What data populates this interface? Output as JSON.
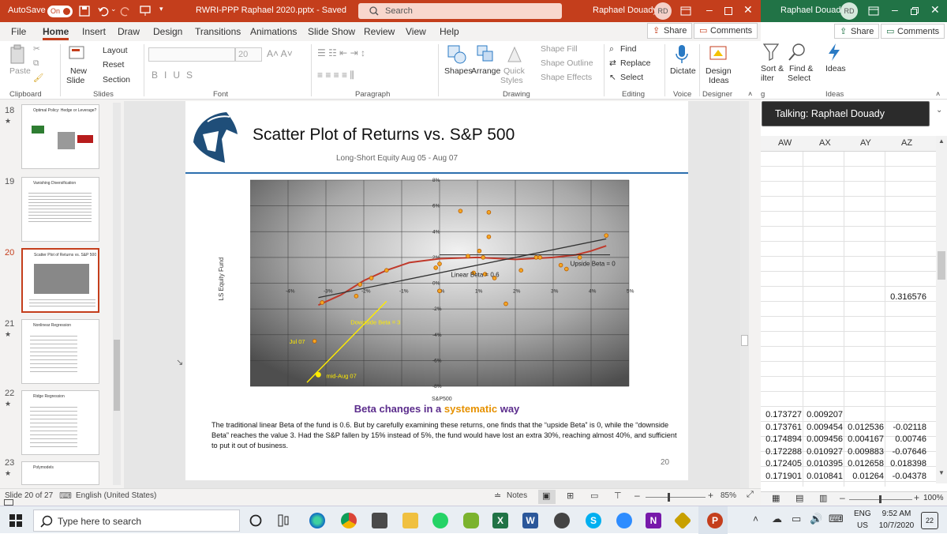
{
  "powerpoint": {
    "autosave_label": "AutoSave",
    "autosave_state": "On",
    "file_title": "RWRI-PPP Raphael 2020.pptx  -  Saved",
    "search_placeholder": "Search",
    "user_name": "Raphael Douady",
    "user_initials": "RD",
    "menu": [
      "File",
      "Home",
      "Insert",
      "Draw",
      "Design",
      "Transitions",
      "Animations",
      "Slide Show",
      "Review",
      "View",
      "Help"
    ],
    "share_label": "Share",
    "comments_label": "Comments",
    "ribbon": {
      "clipboard": {
        "paste": "Paste",
        "group": "Clipboard"
      },
      "slides": {
        "new_slide_1": "New",
        "new_slide_2": "Slide",
        "layout": "Layout",
        "reset": "Reset",
        "section": "Section",
        "group": "Slides"
      },
      "font": {
        "size": "20",
        "group": "Font"
      },
      "paragraph": {
        "group": "Paragraph"
      },
      "drawing": {
        "shapes": "Shapes",
        "arrange": "Arrange",
        "quick_styles_1": "Quick",
        "quick_styles_2": "Styles",
        "shape_fill": "Shape Fill",
        "shape_outline": "Shape Outline",
        "shape_effects": "Shape Effects",
        "group": "Drawing"
      },
      "editing": {
        "find": "Find",
        "replace": "Replace",
        "select": "Select",
        "group": "Editing"
      },
      "voice": {
        "dictate": "Dictate",
        "group": "Voice"
      },
      "designer": {
        "design_ideas_1": "Design",
        "design_ideas_2": "Ideas",
        "group": "Designer"
      }
    },
    "thumbnails": [
      {
        "num": "18",
        "title": "Optimal Policy: Hedge or Leverage?",
        "selected": false
      },
      {
        "num": "19",
        "title": "Vanishing Diversification",
        "selected": false
      },
      {
        "num": "20",
        "title": "Scatter Plot of Returns vs. S&P 500",
        "selected": true
      },
      {
        "num": "21",
        "title": "Nonlinear Regression",
        "selected": false
      },
      {
        "num": "22",
        "title": "Ridge Regression",
        "selected": false
      },
      {
        "num": "23",
        "title": "Polymodels",
        "selected": false
      }
    ],
    "status": {
      "slide_info": "Slide 20 of 27",
      "language": "English (United States)",
      "notes": "Notes",
      "zoom": "85%"
    }
  },
  "slide": {
    "title": "Scatter Plot of Returns vs. S&P 500",
    "subtitle": "Long-Short Equity Aug 05 - Aug 07",
    "headline_part1": "Beta changes in a ",
    "headline_highlight": "systematic",
    "headline_part2": " way",
    "body": "The traditional linear Beta of the fund is 0.6. But by carefully examining these returns, one finds that the “upside Beta” is 0, while the “downside Beta” reaches the value 3. Had the S&P fallen by 15% instead of 5%, the fund would have lost an extra 30%, reaching almost 40%, and sufficient to put it out of business.",
    "page_number": "20"
  },
  "chart_data": {
    "type": "scatter",
    "xlabel": "S&P500",
    "ylabel": "LS Equity Fund",
    "xlim": [
      -5,
      5
    ],
    "ylim": [
      -8,
      8
    ],
    "x_ticks": [
      "-4%",
      "-3%",
      "-2%",
      "-1%",
      "0%",
      "1%",
      "2%",
      "3%",
      "4%",
      "5%"
    ],
    "x_tick_values": [
      -4,
      -3,
      -2,
      -1,
      0,
      1,
      2,
      3,
      4,
      5
    ],
    "y_ticks": [
      "8%",
      "6%",
      "4%",
      "2%",
      "0%",
      "-2%",
      "-4%",
      "-6%",
      "-8%"
    ],
    "y_tick_values": [
      8,
      6,
      4,
      2,
      0,
      -2,
      -4,
      -6,
      -8
    ],
    "points": [
      {
        "x": 0.55,
        "y": 5.6
      },
      {
        "x": 1.3,
        "y": 5.5
      },
      {
        "x": 1.3,
        "y": 3.6
      },
      {
        "x": 1.05,
        "y": 2.5
      },
      {
        "x": 0.75,
        "y": 2.1
      },
      {
        "x": 1.15,
        "y": 2.0
      },
      {
        "x": 0.0,
        "y": 1.5
      },
      {
        "x": -0.1,
        "y": 1.2
      },
      {
        "x": 0.9,
        "y": 0.8
      },
      {
        "x": 1.45,
        "y": 0.4
      },
      {
        "x": 1.2,
        "y": 0.7
      },
      {
        "x": 2.15,
        "y": 1.0
      },
      {
        "x": 2.55,
        "y": 2.0
      },
      {
        "x": 2.65,
        "y": 2.0
      },
      {
        "x": 3.2,
        "y": 1.4
      },
      {
        "x": 3.35,
        "y": 1.1
      },
      {
        "x": 3.7,
        "y": 2.0
      },
      {
        "x": 4.4,
        "y": 3.7
      },
      {
        "x": 1.75,
        "y": -1.6
      },
      {
        "x": 0.0,
        "y": -0.6
      },
      {
        "x": -1.8,
        "y": 0.4
      },
      {
        "x": -2.1,
        "y": -0.1
      },
      {
        "x": -2.2,
        "y": -1.0
      },
      {
        "x": -3.1,
        "y": -1.5
      },
      {
        "x": -1.4,
        "y": 1.0
      },
      {
        "x": -3.3,
        "y": -4.5
      }
    ],
    "special_points": [
      {
        "x": -3.2,
        "y": -7.1,
        "label": "mid-Aug 07"
      },
      {
        "x": -3.3,
        "y": -4.5,
        "label": "Jul 07"
      }
    ],
    "linear_fit": {
      "label": "Linear Beta = 0.6",
      "slope": 0.6,
      "intercept": 0.8,
      "x_range": [
        -3.2,
        4.4
      ]
    },
    "downside_line": {
      "label": "Downside Beta = 3",
      "slope": 3,
      "intercept": 2.8,
      "x_range": [
        -3.5,
        -1.4
      ]
    },
    "upside_line": {
      "label": "Upside Beta = 0",
      "value": 2.2,
      "x_range": [
        0,
        4.5
      ]
    },
    "nonlinear_fit_label": "",
    "nonlinear_fit": [
      [
        -3.2,
        -1.7
      ],
      [
        -2.6,
        -0.9
      ],
      [
        -2.0,
        0.2
      ],
      [
        -1.4,
        1.0
      ],
      [
        -0.8,
        1.6
      ],
      [
        0.0,
        1.9
      ],
      [
        1.0,
        2.0
      ],
      [
        2.0,
        1.85
      ],
      [
        3.0,
        2.0
      ],
      [
        3.6,
        2.2
      ],
      [
        4.0,
        2.5
      ],
      [
        4.4,
        2.9
      ]
    ],
    "colors": {
      "points": "#f5a623",
      "point_stroke": "#b85c00",
      "fit": "#c0392b",
      "linear": "#333333",
      "yellow": "#ffec00"
    },
    "grid": true
  },
  "excel": {
    "user_name": "Raphael Douady",
    "user_initials": "RD",
    "share_label": "Share",
    "comments_label": "Comments",
    "ribbon": {
      "sort_1": "Sort &",
      "sort_2": "ilter",
      "find_1": "Find &",
      "find_2": "Select",
      "ideas": "Ideas",
      "ideas_group": "Ideas",
      "group_left": "g"
    },
    "talking_label": "Talking: Raphael Douady",
    "columns": [
      "AW",
      "AX",
      "AY",
      "AZ"
    ],
    "single_cell": "0.316576",
    "rows": [
      [
        "0.173727",
        "0.009207",
        "",
        ""
      ],
      [
        "0.173761",
        "0.009454",
        "0.012536",
        "-0.02118"
      ],
      [
        "0.174894",
        "0.009456",
        "0.004167",
        "0.00746"
      ],
      [
        "0.172288",
        "0.010927",
        "0.009883",
        "-0.07646"
      ],
      [
        "0.172405",
        "0.010395",
        "0.012658",
        "0.018398"
      ],
      [
        "0.171901",
        "0.010841",
        "0.01264",
        "-0.04378"
      ]
    ],
    "zoom": "100%"
  },
  "taskbar": {
    "search_placeholder": "Type here to search",
    "lang_1": "ENG",
    "lang_2": "US",
    "time": "9:52 AM",
    "date": "10/7/2020",
    "notifications": "22"
  }
}
